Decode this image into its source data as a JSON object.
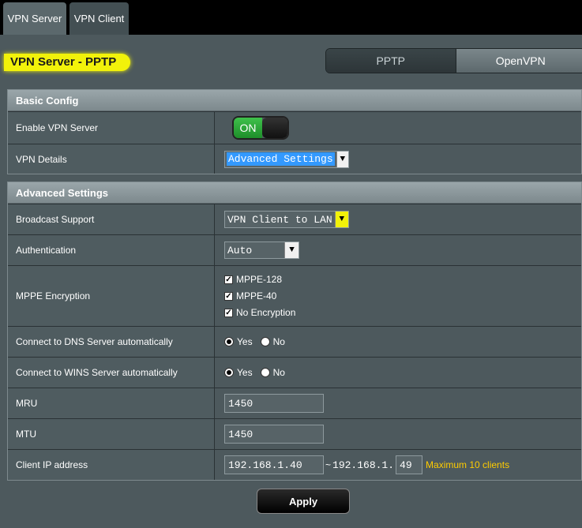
{
  "tabs": [
    {
      "label": "VPN Server",
      "active": true
    },
    {
      "label": "VPN Client",
      "active": false
    }
  ],
  "page_title": "VPN Server - PPTP",
  "mode_switch": {
    "pptp": "PPTP",
    "openvpn": "OpenVPN",
    "selected": "OpenVPN"
  },
  "basic_config": {
    "title": "Basic Config",
    "enable_vpn": {
      "label": "Enable VPN Server",
      "state": "ON"
    },
    "vpn_details": {
      "label": "VPN Details",
      "value": "Advanced Settings"
    }
  },
  "advanced": {
    "title": "Advanced Settings",
    "broadcast": {
      "label": "Broadcast Support",
      "value": "VPN Client to LAN"
    },
    "auth": {
      "label": "Authentication",
      "value": "Auto"
    },
    "mppe": {
      "label": "MPPE Encryption",
      "options": [
        {
          "label": "MPPE-128",
          "checked": true
        },
        {
          "label": "MPPE-40",
          "checked": true
        },
        {
          "label": "No Encryption",
          "checked": true
        }
      ]
    },
    "dns": {
      "label": "Connect to DNS Server automatically",
      "yes": "Yes",
      "no": "No",
      "selected": "Yes"
    },
    "wins": {
      "label": "Connect to WINS Server automatically",
      "yes": "Yes",
      "no": "No",
      "selected": "Yes"
    },
    "mru": {
      "label": "MRU",
      "value": "1450"
    },
    "mtu": {
      "label": "MTU",
      "value": "1450"
    },
    "client_ip": {
      "label": "Client IP address",
      "start": "192.168.1.40",
      "separator": "~",
      "end_prefix": "192.168.1.",
      "end_suffix": "49",
      "note": "Maximum 10 clients"
    }
  },
  "apply_label": "Apply",
  "colors": {
    "title_highlight": "#f2f20a",
    "toggle_on": "#2fa83a",
    "note": "#ffcc00"
  }
}
